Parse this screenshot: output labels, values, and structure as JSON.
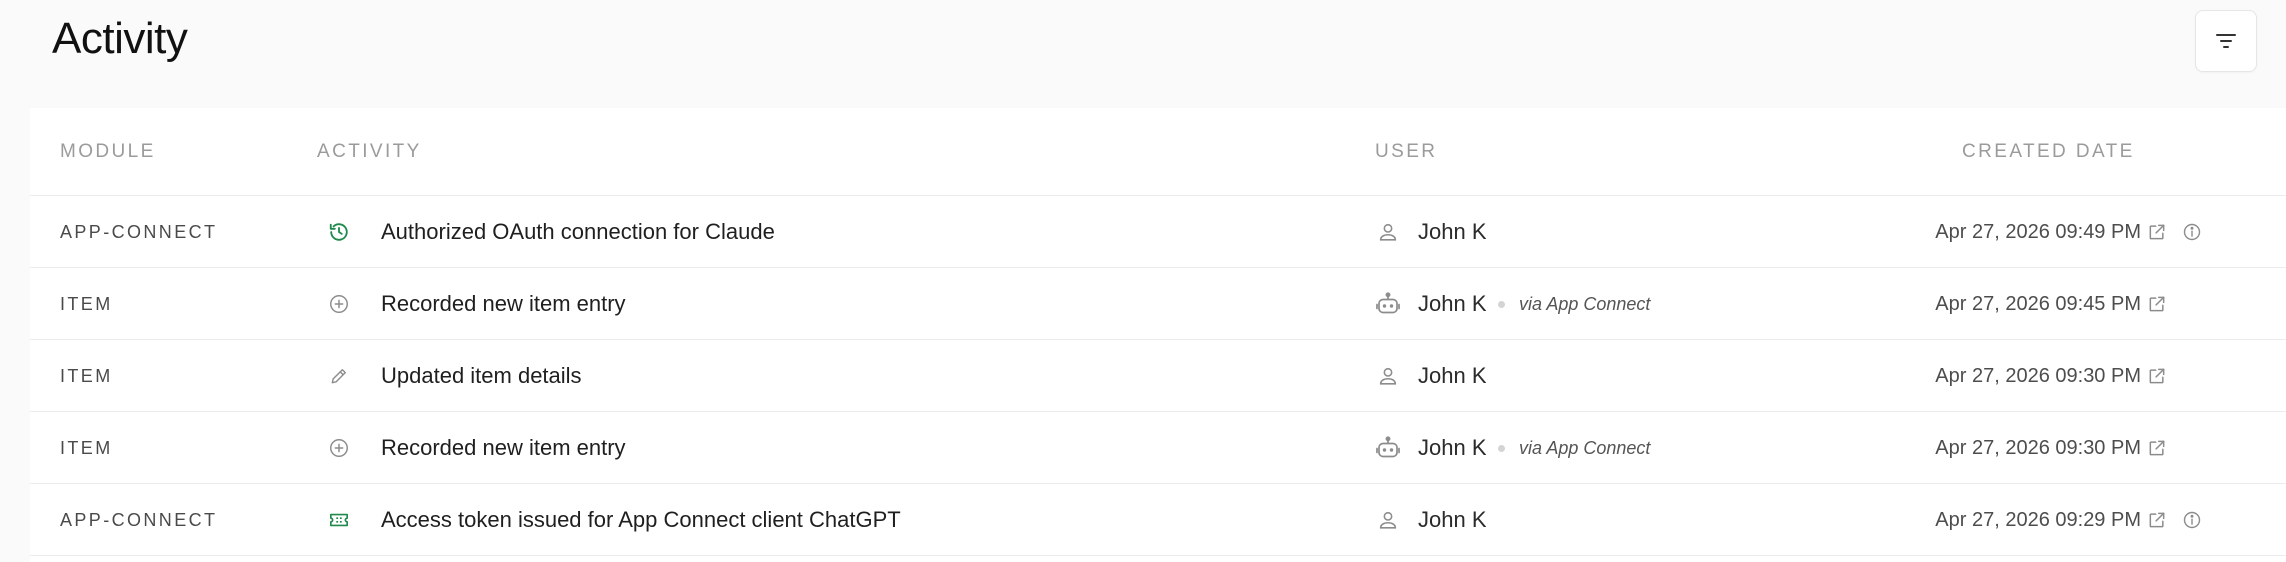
{
  "header": {
    "title": "Activity",
    "filter_icon": "filter-icon"
  },
  "table": {
    "columns": [
      "MODULE",
      "ACTIVITY",
      "USER",
      "CREATED DATE"
    ],
    "rows": [
      {
        "module": "APP-CONNECT",
        "activity_icon": "history-icon",
        "activity": "Authorized OAuth connection for Claude",
        "user_icon": "person-icon",
        "user": "John K",
        "via": "",
        "date": "Apr 27, 2026 09:49 PM",
        "info": true
      },
      {
        "module": "ITEM",
        "activity_icon": "plus-circle-icon",
        "activity": "Recorded new item entry",
        "user_icon": "robot-icon",
        "user": "John K",
        "via": "via App Connect",
        "date": "Apr 27, 2026 09:45 PM",
        "info": false
      },
      {
        "module": "ITEM",
        "activity_icon": "pencil-icon",
        "activity": "Updated item details",
        "user_icon": "person-icon",
        "user": "John K",
        "via": "",
        "date": "Apr 27, 2026 09:30 PM",
        "info": false
      },
      {
        "module": "ITEM",
        "activity_icon": "plus-circle-icon",
        "activity": "Recorded new item entry",
        "user_icon": "robot-icon",
        "user": "John K",
        "via": "via App Connect",
        "date": "Apr 27, 2026 09:30 PM",
        "info": false
      },
      {
        "module": "APP-CONNECT",
        "activity_icon": "ticket-icon",
        "activity": "Access token issued for App Connect client ChatGPT",
        "user_icon": "person-icon",
        "user": "John K",
        "via": "",
        "date": "Apr 27, 2026 09:29 PM",
        "info": true
      }
    ]
  },
  "colors": {
    "accent_green": "#1f8a4c",
    "muted_icon": "#8c8c8c",
    "border": "#ececec"
  }
}
